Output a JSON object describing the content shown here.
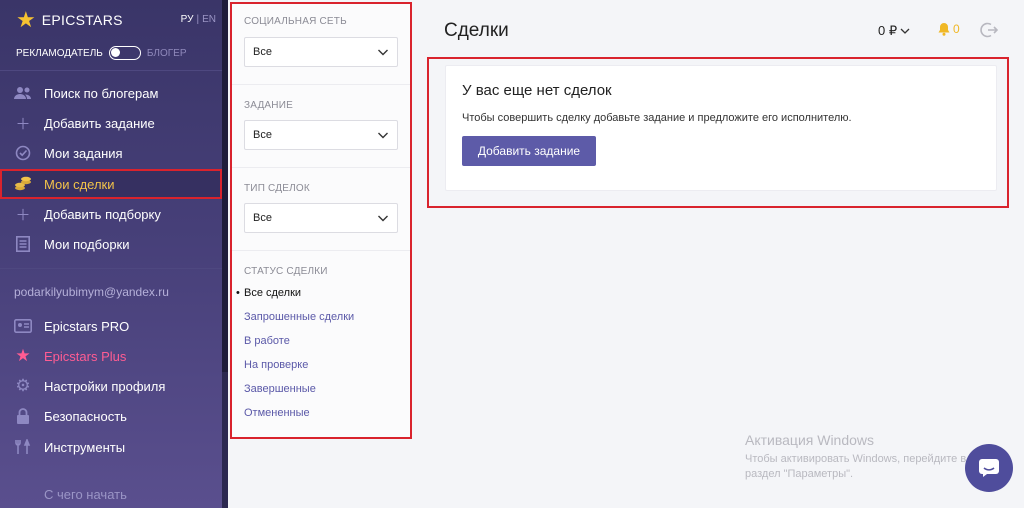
{
  "brand": {
    "name": "EPICSTARS",
    "lang_active": "РУ",
    "lang_other": "EN"
  },
  "mode": {
    "advertiser": "РЕКЛАМОДАТЕЛЬ",
    "blogger": "БЛОГЕР"
  },
  "sidebar": {
    "nav": [
      {
        "label": "Поиск по блогерам",
        "icon": "users-icon"
      },
      {
        "label": "Добавить задание",
        "icon": "plus-icon"
      },
      {
        "label": "Мои задания",
        "icon": "check-circle-icon"
      },
      {
        "label": "Мои сделки",
        "icon": "coins-icon",
        "active": true
      },
      {
        "label": "Добавить подборку",
        "icon": "plus-icon"
      },
      {
        "label": "Мои подборки",
        "icon": "list-icon"
      }
    ],
    "email": "podarkilyubimym@yandex.ru",
    "account": [
      {
        "label": "Epicstars PRO",
        "icon": "id-card-icon"
      },
      {
        "label": "Epicstars Plus",
        "icon": "star-icon"
      },
      {
        "label": "Настройки профиля",
        "icon": "gear-icon"
      },
      {
        "label": "Безопасность",
        "icon": "lock-icon"
      },
      {
        "label": "Инструменты",
        "icon": "tools-icon"
      }
    ],
    "footer_link": "С чего начать"
  },
  "filters": {
    "social": {
      "label": "СОЦИАЛЬНАЯ СЕТЬ",
      "value": "Все"
    },
    "task": {
      "label": "ЗАДАНИЕ",
      "value": "Все"
    },
    "deal_type": {
      "label": "ТИП СДЕЛОК",
      "value": "Все"
    },
    "status": {
      "label": "СТАТУС СДЕЛКИ",
      "items": [
        "Все сделки",
        "Запрошенные сделки",
        "В работе",
        "На проверке",
        "Завершенные",
        "Отмененные"
      ]
    }
  },
  "header": {
    "title": "Сделки",
    "balance": "0 ₽",
    "notifications": "0"
  },
  "empty": {
    "title": "У вас еще нет сделок",
    "text": "Чтобы совершить сделку добавьте задание и предложите его исполнителю.",
    "button": "Добавить задание"
  },
  "watermark": {
    "title": "Активация Windows",
    "line1": "Чтобы активировать Windows, перейдите в",
    "line2": "раздел \"Параметры\"."
  },
  "colors": {
    "accent": "#5d5ba8",
    "highlight": "#d9232d",
    "active_nav": "#f2c34a",
    "plus_nav": "#ff5c93"
  }
}
